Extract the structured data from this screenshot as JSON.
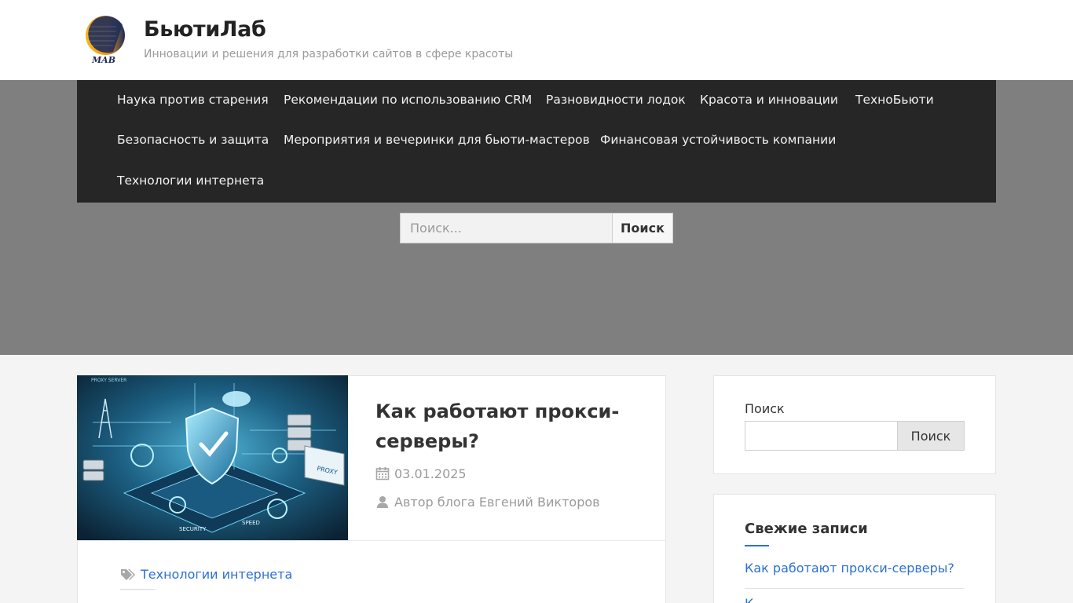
{
  "header": {
    "logo_text": "MAB",
    "site_title": "БьютиЛаб",
    "site_description": "Инновации и решения для разработки сайтов в сфере красоты"
  },
  "nav": {
    "items": [
      {
        "label": "Наука против старения"
      },
      {
        "label": "Рекомендации по использованию CRM"
      },
      {
        "label": "Разновидности лодок"
      },
      {
        "label": "Красота и инновации"
      },
      {
        "label": "ТехноБьюти"
      },
      {
        "label": "Безопасность и защита"
      },
      {
        "label": "Мероприятия и вечеринки для бьюти-мастеров"
      },
      {
        "label": "Финансовая устойчивость компании"
      },
      {
        "label": "Технологии интернета"
      }
    ]
  },
  "hero_search": {
    "placeholder": "Поиск...",
    "button_label": "Поиск"
  },
  "post": {
    "title": "Как работают прокси-серверы?",
    "date": "03.01.2025",
    "author": "Автор блога Евгений Викторов",
    "category": "Технологии интернета",
    "thumbnail_labels": [
      "PROXY SERVER",
      "SECURITY",
      "SPEED",
      "PROXY"
    ]
  },
  "sidebar": {
    "search": {
      "label": "Поиск",
      "button_label": "Поиск"
    },
    "recent": {
      "title": "Свежие записи",
      "items": [
        {
          "label": "Как работают прокси-серверы?"
        },
        {
          "label": "К..."
        }
      ]
    }
  },
  "colors": {
    "nav_bg": "#262626",
    "hero_bg": "#7f7f7f",
    "link": "#2d6fd6"
  }
}
